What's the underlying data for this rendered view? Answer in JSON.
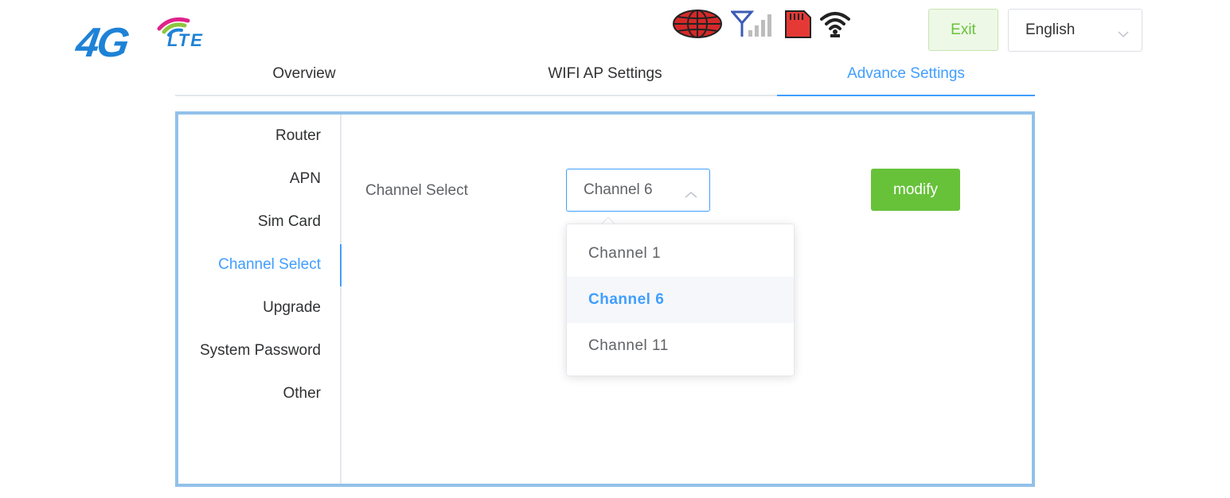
{
  "header": {
    "logo": {
      "main_text": "4G",
      "sub_text": "LTE",
      "colors": {
        "blue": "#1e82d6",
        "pink": "#e0218a",
        "green": "#8dc63f"
      }
    },
    "status_icons": [
      {
        "name": "globe-icon",
        "color": "#d62828"
      },
      {
        "name": "signal-antenna-icon",
        "color": "#3b5bb5"
      },
      {
        "name": "sim-card-icon",
        "color": "#e53935"
      },
      {
        "name": "wifi-icon",
        "color": "#222222"
      }
    ],
    "exit_label": "Exit",
    "language": {
      "selected": "English"
    }
  },
  "tabs": [
    {
      "label": "Overview",
      "active": false
    },
    {
      "label": "WIFI AP Settings",
      "active": false
    },
    {
      "label": "Advance Settings",
      "active": true
    }
  ],
  "sidebar": {
    "items": [
      {
        "label": "Router",
        "active": false
      },
      {
        "label": "APN",
        "active": false
      },
      {
        "label": "Sim Card",
        "active": false
      },
      {
        "label": "Channel Select",
        "active": true
      },
      {
        "label": "Upgrade",
        "active": false
      },
      {
        "label": "System Password",
        "active": false
      },
      {
        "label": "Other",
        "active": false
      }
    ]
  },
  "main": {
    "field_label": "Channel Select",
    "select_value": "Channel 6",
    "modify_label": "modify",
    "dropdown_options": [
      {
        "label": "Channel 1",
        "selected": false
      },
      {
        "label": "Channel 6",
        "selected": true
      },
      {
        "label": "Channel 11",
        "selected": false
      }
    ]
  },
  "colors": {
    "accent": "#409eff",
    "success": "#67c23a",
    "panel_border": "#92c1ea"
  }
}
